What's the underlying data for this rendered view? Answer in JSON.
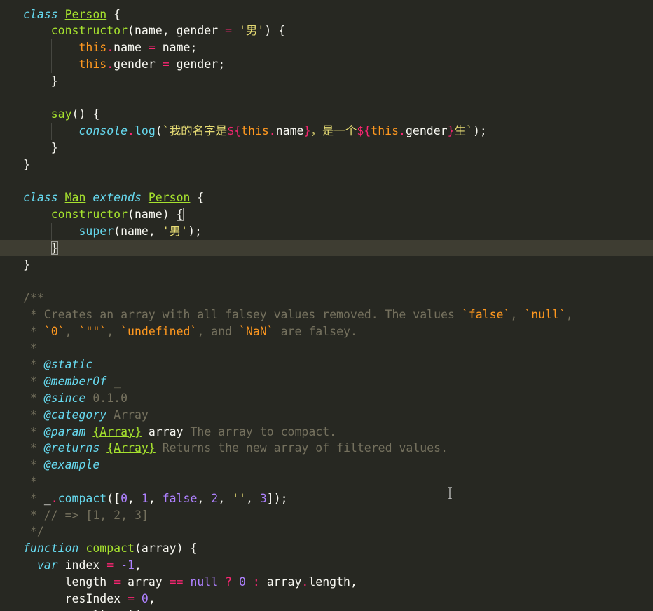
{
  "editor": {
    "lines": [
      [
        {
          "t": "class",
          "c": "kw-it"
        },
        {
          "t": " "
        },
        {
          "t": "Person",
          "c": "cls"
        },
        {
          "t": " {"
        }
      ],
      [
        {
          "t": "    "
        },
        {
          "t": "constructor",
          "c": "fn"
        },
        {
          "t": "(name, gender "
        },
        {
          "t": "=",
          "c": "op"
        },
        {
          "t": " "
        },
        {
          "t": "'男'",
          "c": "str"
        },
        {
          "t": ") {"
        }
      ],
      [
        {
          "t": "        "
        },
        {
          "t": "this",
          "c": "this"
        },
        {
          "t": ".",
          "c": "op"
        },
        {
          "t": "name "
        },
        {
          "t": "=",
          "c": "op"
        },
        {
          "t": " name;"
        }
      ],
      [
        {
          "t": "        "
        },
        {
          "t": "this",
          "c": "this"
        },
        {
          "t": ".",
          "c": "op"
        },
        {
          "t": "gender "
        },
        {
          "t": "=",
          "c": "op"
        },
        {
          "t": " gender;"
        }
      ],
      [
        {
          "t": "    }"
        }
      ],
      [
        {
          "t": ""
        }
      ],
      [
        {
          "t": "    "
        },
        {
          "t": "say",
          "c": "fn"
        },
        {
          "t": "() {"
        }
      ],
      [
        {
          "t": "        "
        },
        {
          "t": "console",
          "c": "support"
        },
        {
          "t": ".",
          "c": "op"
        },
        {
          "t": "log",
          "c": "method"
        },
        {
          "t": "("
        },
        {
          "t": "`我的名字是",
          "c": "str"
        },
        {
          "t": "${",
          "c": "kw"
        },
        {
          "t": "this",
          "c": "this"
        },
        {
          "t": ".",
          "c": "op"
        },
        {
          "t": "name"
        },
        {
          "t": "}",
          "c": "kw"
        },
        {
          "t": "，是一个",
          "c": "str"
        },
        {
          "t": "${",
          "c": "kw"
        },
        {
          "t": "this",
          "c": "this"
        },
        {
          "t": ".",
          "c": "op"
        },
        {
          "t": "gender"
        },
        {
          "t": "}",
          "c": "kw"
        },
        {
          "t": "生`",
          "c": "str"
        },
        {
          "t": ");"
        }
      ],
      [
        {
          "t": "    }"
        }
      ],
      [
        {
          "t": "}"
        }
      ],
      [
        {
          "t": ""
        }
      ],
      [
        {
          "t": "class",
          "c": "kw-it"
        },
        {
          "t": " "
        },
        {
          "t": "Man",
          "c": "cls"
        },
        {
          "t": " "
        },
        {
          "t": "extends",
          "c": "kw-it"
        },
        {
          "t": " "
        },
        {
          "t": "Person",
          "c": "cls"
        },
        {
          "t": " {"
        }
      ],
      [
        {
          "t": "    "
        },
        {
          "t": "constructor",
          "c": "fn"
        },
        {
          "t": "(name) "
        },
        {
          "t": "{",
          "c": "bracket-box"
        }
      ],
      [
        {
          "t": "        "
        },
        {
          "t": "super",
          "c": "method"
        },
        {
          "t": "(name, "
        },
        {
          "t": "'男'",
          "c": "str"
        },
        {
          "t": ");"
        }
      ],
      [
        {
          "t": "    "
        },
        {
          "t": "}",
          "c": "bracket-box"
        }
      ],
      [
        {
          "t": "}"
        }
      ],
      [
        {
          "t": ""
        }
      ],
      [
        {
          "t": "/**",
          "c": "cmt"
        }
      ],
      [
        {
          "t": " * Creates an array with all falsey values removed. The values ",
          "c": "cmt"
        },
        {
          "t": "`false`",
          "c": "cmt-code"
        },
        {
          "t": ", ",
          "c": "cmt"
        },
        {
          "t": "`null`",
          "c": "cmt-code"
        },
        {
          "t": ",",
          "c": "cmt"
        }
      ],
      [
        {
          "t": " * ",
          "c": "cmt"
        },
        {
          "t": "`0`",
          "c": "cmt-code"
        },
        {
          "t": ", ",
          "c": "cmt"
        },
        {
          "t": "`\"\"`",
          "c": "cmt-code"
        },
        {
          "t": ", ",
          "c": "cmt"
        },
        {
          "t": "`undefined`",
          "c": "cmt-code"
        },
        {
          "t": ", and ",
          "c": "cmt"
        },
        {
          "t": "`NaN`",
          "c": "cmt-code"
        },
        {
          "t": " are falsey.",
          "c": "cmt"
        }
      ],
      [
        {
          "t": " *",
          "c": "cmt"
        }
      ],
      [
        {
          "t": " * ",
          "c": "cmt"
        },
        {
          "t": "@static",
          "c": "cmt-tag"
        }
      ],
      [
        {
          "t": " * ",
          "c": "cmt"
        },
        {
          "t": "@memberOf",
          "c": "cmt-tag"
        },
        {
          "t": " _",
          "c": "cmt"
        }
      ],
      [
        {
          "t": " * ",
          "c": "cmt"
        },
        {
          "t": "@since",
          "c": "cmt-tag"
        },
        {
          "t": " 0.1.0",
          "c": "cmt"
        }
      ],
      [
        {
          "t": " * ",
          "c": "cmt"
        },
        {
          "t": "@category",
          "c": "cmt-tag"
        },
        {
          "t": " Array",
          "c": "cmt"
        }
      ],
      [
        {
          "t": " * ",
          "c": "cmt"
        },
        {
          "t": "@param",
          "c": "cmt-tag"
        },
        {
          "t": " "
        },
        {
          "t": "{Array}",
          "c": "cmt-type"
        },
        {
          "t": " "
        },
        {
          "t": "array",
          "c": "cmt-name"
        },
        {
          "t": " The array to compact.",
          "c": "cmt"
        }
      ],
      [
        {
          "t": " * ",
          "c": "cmt"
        },
        {
          "t": "@returns",
          "c": "cmt-tag"
        },
        {
          "t": " "
        },
        {
          "t": "{Array}",
          "c": "cmt-type"
        },
        {
          "t": " Returns the new array of filtered values.",
          "c": "cmt"
        }
      ],
      [
        {
          "t": " * ",
          "c": "cmt"
        },
        {
          "t": "@example",
          "c": "cmt-tag"
        }
      ],
      [
        {
          "t": " *",
          "c": "cmt"
        }
      ],
      [
        {
          "t": " * ",
          "c": "cmt"
        },
        {
          "t": "_"
        },
        {
          "t": ".",
          "c": "op"
        },
        {
          "t": "compact",
          "c": "method"
        },
        {
          "t": "(["
        },
        {
          "t": "0",
          "c": "num"
        },
        {
          "t": ", "
        },
        {
          "t": "1",
          "c": "num"
        },
        {
          "t": ", "
        },
        {
          "t": "false",
          "c": "num"
        },
        {
          "t": ", "
        },
        {
          "t": "2",
          "c": "num"
        },
        {
          "t": ", "
        },
        {
          "t": "''",
          "c": "str"
        },
        {
          "t": ", "
        },
        {
          "t": "3",
          "c": "num"
        },
        {
          "t": "]);"
        }
      ],
      [
        {
          "t": " * // => [1, 2, 3]",
          "c": "cmt"
        }
      ],
      [
        {
          "t": " */",
          "c": "cmt"
        }
      ],
      [
        {
          "t": "function",
          "c": "kw-it"
        },
        {
          "t": " "
        },
        {
          "t": "compact",
          "c": "fn"
        },
        {
          "t": "(array) {"
        }
      ],
      [
        {
          "t": "  "
        },
        {
          "t": "var",
          "c": "kw-it"
        },
        {
          "t": " index "
        },
        {
          "t": "=",
          "c": "op"
        },
        {
          "t": " "
        },
        {
          "t": "-1",
          "c": "num"
        },
        {
          "t": ","
        }
      ],
      [
        {
          "t": "      length "
        },
        {
          "t": "=",
          "c": "op"
        },
        {
          "t": " array "
        },
        {
          "t": "==",
          "c": "op"
        },
        {
          "t": " "
        },
        {
          "t": "null",
          "c": "num"
        },
        {
          "t": " "
        },
        {
          "t": "?",
          "c": "op"
        },
        {
          "t": " "
        },
        {
          "t": "0",
          "c": "num"
        },
        {
          "t": " "
        },
        {
          "t": ":",
          "c": "op"
        },
        {
          "t": " array"
        },
        {
          "t": ".",
          "c": "op"
        },
        {
          "t": "length,"
        }
      ],
      [
        {
          "t": "      resIndex "
        },
        {
          "t": "=",
          "c": "op"
        },
        {
          "t": " "
        },
        {
          "t": "0",
          "c": "num"
        },
        {
          "t": ","
        }
      ],
      [
        {
          "t": "      result "
        },
        {
          "t": "=",
          "c": "op"
        },
        {
          "t": " [];"
        }
      ]
    ],
    "current_line": 14,
    "guides": [
      {
        "lines": [
          1,
          2,
          3,
          4,
          5,
          6,
          7,
          8
        ],
        "col": 0
      },
      {
        "lines": [
          2,
          3
        ],
        "col": 1
      },
      {
        "lines": [
          7
        ],
        "col": 1
      },
      {
        "lines": [
          12,
          13,
          14
        ],
        "col": 0
      },
      {
        "lines": [
          13
        ],
        "col": 1
      },
      {
        "lines": [
          17,
          18,
          19,
          20,
          21,
          22,
          23,
          24,
          25,
          26,
          27,
          28,
          29,
          30,
          31
        ],
        "col": 0
      },
      {
        "lines": [
          34,
          35,
          36
        ],
        "col": 0
      }
    ]
  }
}
